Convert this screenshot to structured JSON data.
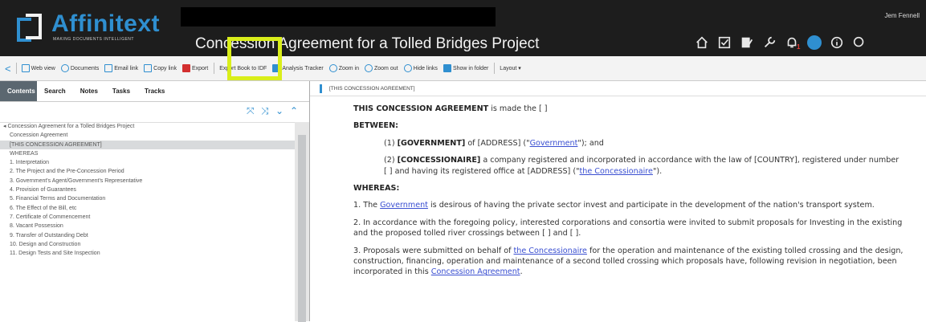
{
  "app": {
    "name": "Affinitext",
    "tagline": "MAKING DOCUMENTS INTELLIGENT",
    "doc_title": "Concession Agreement for a Tolled Bridges Project",
    "user": "Jem Fennell",
    "notif_count": "1"
  },
  "header_icons": [
    "home-icon",
    "task-icon",
    "edit-icon",
    "wrench-icon",
    "bell-icon",
    "chat-icon",
    "info-icon",
    "search-icon"
  ],
  "toolbar": {
    "back": "<",
    "web_view": "Web view",
    "documents": "Documents",
    "email_link": "Email link",
    "copy_link": "Copy link",
    "export": "Export",
    "export_book": "Export Book to IDF",
    "analysis_tracker": "Analysis Tracker",
    "zoom_in": "Zoom in",
    "zoom_out": "Zoom out",
    "hide_links": "Hide links",
    "show_in_folder": "Show in folder",
    "layout": "Layout ▾"
  },
  "left": {
    "tabs": [
      "Contents",
      "Search",
      "Notes",
      "Tasks",
      "Tracks"
    ],
    "tree": [
      {
        "label": "Concession Agreement for a Tolled Bridges Project",
        "level": "root"
      },
      {
        "label": "Concession Agreement",
        "level": "child"
      },
      {
        "label": "[THIS CONCESSION AGREEMENT]",
        "level": "child",
        "selected": true
      },
      {
        "label": "WHEREAS",
        "level": "child"
      },
      {
        "label": "1. Interpretation",
        "level": "child"
      },
      {
        "label": "2. The Project and the Pre-Concession Period",
        "level": "child"
      },
      {
        "label": "3. Government's Agent/Government's Representative",
        "level": "child"
      },
      {
        "label": "4. Provision of Guarantees",
        "level": "child"
      },
      {
        "label": "5. Financial Terms and Documentation",
        "level": "child"
      },
      {
        "label": "6. The Effect of the Bill, etc",
        "level": "child"
      },
      {
        "label": "7. Certificate of Commencement",
        "level": "child"
      },
      {
        "label": "8. Vacant Possession",
        "level": "child"
      },
      {
        "label": "9. Transfer of Outstanding Debt",
        "level": "child"
      },
      {
        "label": "10. Design and Construction",
        "level": "child"
      },
      {
        "label": "11. Design Tests and Site Inspection",
        "level": "child"
      }
    ]
  },
  "content": {
    "breadcrumb": "[THIS CONCESSION AGREEMENT]",
    "intro_bold": "THIS CONCESSION AGREEMENT",
    "intro_rest": " is made the [    ]",
    "between": "BETWEEN:",
    "p1_a": "(1) ",
    "p1_b": "[GOVERNMENT]",
    "p1_c": " of [ADDRESS] (\"",
    "p1_link": "Government",
    "p1_d": "\"); and",
    "p2_a": "(2) ",
    "p2_b": "[CONCESSIONAIRE]",
    "p2_c": " a company registered and incorporated in accordance with the law of [COUNTRY], registered under number [    ] and having its registered office at [ADDRESS] (\"",
    "p2_link": "the Concessionaire",
    "p2_d": "\").",
    "whereas": "WHEREAS:",
    "w1_a": "1. The ",
    "w1_link": "Government",
    "w1_b": " is desirous of having the private sector invest and participate in the development of the nation's transport system.",
    "w2": "2. In accordance with the foregoing policy, interested corporations and consortia were invited to submit proposals for Investing in the existing and the proposed tolled river crossings between [    ] and [    ].",
    "w3_a": "3. Proposals were submitted on behalf of ",
    "w3_link1": "the Concessionaire",
    "w3_b": " for the operation and maintenance of the existing tolled crossing and the design, construction, financing, operation and maintenance of a second tolled crossing which proposals have, following revision in negotiation, been incorporated in this ",
    "w3_link2": "Concession Agreement",
    "w3_c": "."
  },
  "colors": {
    "header_bg": "#1d1d1d",
    "brand": "#2f8fd0",
    "highlight": "#d9ee1a",
    "tab_active": "#5b6770"
  }
}
